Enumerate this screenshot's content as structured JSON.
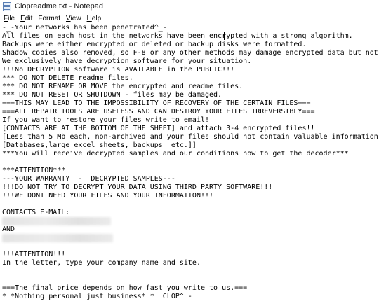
{
  "window": {
    "title": "Clopreadme.txt - Notepad"
  },
  "menu": [
    {
      "label": "File",
      "accel": "F",
      "rest": "ile"
    },
    {
      "label": "Edit",
      "accel": "E",
      "rest": "dit"
    },
    {
      "label": "Format",
      "accel": "",
      "rest": "Format"
    },
    {
      "label": "View",
      "accel": "V",
      "rest": "iew"
    },
    {
      "label": "Help",
      "accel": "H",
      "rest": "elp"
    }
  ],
  "editor": {
    "lines": [
      "-_-Your networks has been penetrated^_-",
      "All files on each host in the networks have been encrypted with a strong algorithm.",
      "Backups were either encrypted or deleted or backup disks were formatted.",
      "Shadow copies also removed, so F-8 or any other methods may damage encrypted data but not recover.",
      "We exclusively have decryption software for your situation.",
      "!!!No DECRYPTION software is AVAILABLE in the PUBLIC!!!",
      "*** DO NOT DELETE readme files.",
      "*** DO NOT RENAME OR MOVE the encrypted and readme files.",
      "*** DO NOT RESET OR SHUTDOWN - files may be damaged.",
      "===THIS MAY LEAD TO THE IMPOSSIBILITY OF RECOVERY OF THE CERTAIN FILES===",
      "===ALL REPAIR TOOLS ARE USELESS AND CAN DESTROY YOUR FILES IRREVERSIBLY===",
      "If you want to restore your files write to email!",
      "[CONTACTS ARE AT THE BOTTOM OF THE SHEET] and attach 3-4 encrypted files!!!",
      "[Less than 5 Mb each, non-archived and your files should not contain valuable information.",
      "[Databases,large excel sheets, backups  etc.]]",
      "***You will receive decrypted samples and our conditions how to get the decoder***",
      "",
      "***ATTENTION***",
      "---YOUR WARRANTY  -  DECRYPTED SAMPLES---",
      "!!!DO NOT TRY TO DECRYPT YOUR DATA USING THIRD PARTY SOFTWARE!!!",
      "!!!WE DONT NEED YOUR FILES AND YOUR INFORMATION!!!",
      "",
      "CONTACTS E-MAIL:",
      "",
      "AND",
      "",
      "",
      "!!!ATTENTION!!!",
      "In the letter, type your company name and site.",
      "",
      "",
      "===The final price depends on how fast you write to us.===",
      "*_*Nothing personal just business*_*  CLOP^_-"
    ]
  }
}
